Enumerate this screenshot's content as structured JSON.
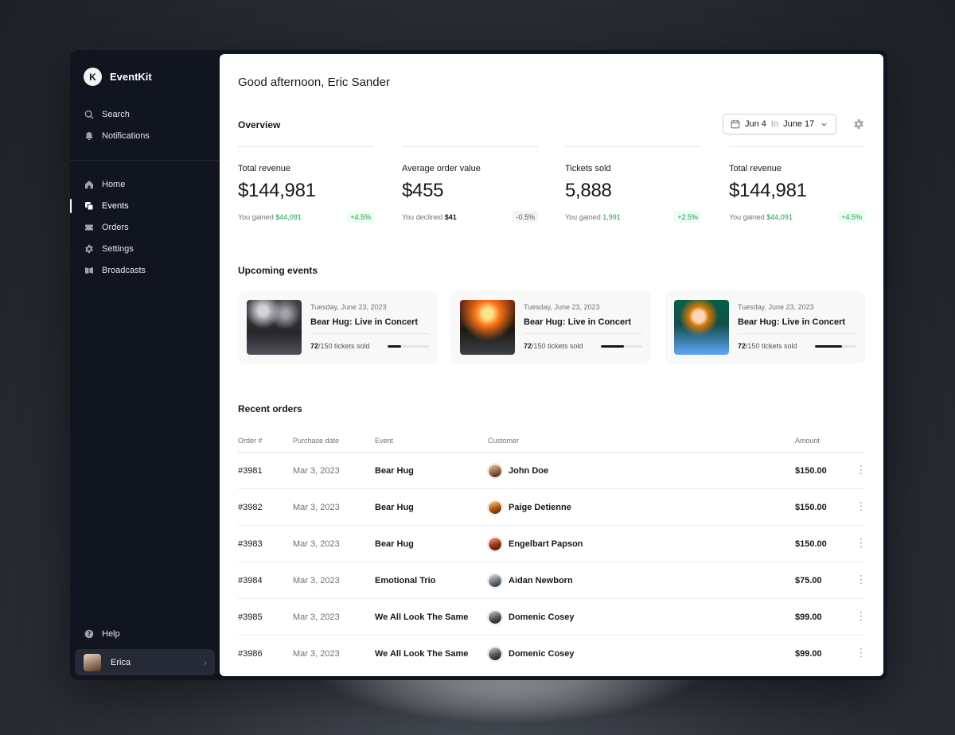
{
  "app": {
    "name": "EventKit",
    "logo_letter": "K"
  },
  "sidebar": {
    "top_items": [
      {
        "label": "Search",
        "icon": "search-icon"
      },
      {
        "label": "Notifications",
        "icon": "bell-icon"
      }
    ],
    "items": [
      {
        "label": "Home",
        "icon": "home-icon"
      },
      {
        "label": "Events",
        "icon": "squares-icon",
        "active": true
      },
      {
        "label": "Orders",
        "icon": "ticket-icon"
      },
      {
        "label": "Settings",
        "icon": "gear-icon"
      },
      {
        "label": "Broadcasts",
        "icon": "megaphone-icon"
      }
    ],
    "help": {
      "label": "Help",
      "icon": "question-icon"
    },
    "user": {
      "name": "Erica"
    }
  },
  "main": {
    "greeting": "Good afternoon, Eric Sander",
    "overview": {
      "title": "Overview",
      "date_from": "Jun 4",
      "date_to_word": "to",
      "date_to": "June 17",
      "stats": [
        {
          "label": "Total revenue",
          "value": "$144,981",
          "foot_prefix": "You gained",
          "foot_value": "$44,091",
          "badge": "+4.5%",
          "trend": "up"
        },
        {
          "label": "Average order value",
          "value": "$455",
          "foot_prefix": "You declined",
          "foot_value": "$41",
          "badge": "-0.5%",
          "trend": "down"
        },
        {
          "label": "Tickets sold",
          "value": "5,888",
          "foot_prefix": "You gained",
          "foot_value": "1,991",
          "badge": "+2.5%",
          "trend": "up"
        },
        {
          "label": "Total revenue",
          "value": "$144,981",
          "foot_prefix": "You gained",
          "foot_value": "$44,091",
          "badge": "+4.5%",
          "trend": "up"
        }
      ]
    },
    "upcoming": {
      "title": "Upcoming events",
      "events": [
        {
          "date": "Tuesday, June 23, 2023",
          "name": "Bear Hug: Live in Concert",
          "sold": "72",
          "total_suffix": "/150 tickets sold",
          "progress": 0.32
        },
        {
          "date": "Tuesday, June 23, 2023",
          "name": "Bear Hug: Live in Concert",
          "sold": "72",
          "total_suffix": "/150 tickets sold",
          "progress": 0.55
        },
        {
          "date": "Tuesday, June 23, 2023",
          "name": "Bear Hug: Live in Concert",
          "sold": "72",
          "total_suffix": "/150 tickets sold",
          "progress": 0.65
        }
      ]
    },
    "orders": {
      "title": "Recent orders",
      "columns": [
        "Order #",
        "Purchase date",
        "Event",
        "Customer",
        "Amount"
      ],
      "rows": [
        {
          "id": "#3981",
          "date": "Mar 3, 2023",
          "event": "Bear Hug",
          "customer": "John Doe",
          "amount": "$150.00"
        },
        {
          "id": "#3982",
          "date": "Mar 3, 2023",
          "event": "Bear Hug",
          "customer": "Paige Detienne",
          "amount": "$150.00"
        },
        {
          "id": "#3983",
          "date": "Mar 3, 2023",
          "event": "Bear Hug",
          "customer": "Engelbart Papson",
          "amount": "$150.00"
        },
        {
          "id": "#3984",
          "date": "Mar 3, 2023",
          "event": "Emotional Trio",
          "customer": "Aidan Newborn",
          "amount": "$75.00"
        },
        {
          "id": "#3985",
          "date": "Mar 3, 2023",
          "event": "We All Look The Same",
          "customer": "Domenic Cosey",
          "amount": "$99.00"
        },
        {
          "id": "#3986",
          "date": "Mar 3, 2023",
          "event": "We All Look The Same",
          "customer": "Domenic Cosey",
          "amount": "$99.00"
        }
      ]
    }
  },
  "colors": {
    "sidebar_bg": "#111520",
    "positive": "#16a34a",
    "accent": "#18181b"
  }
}
